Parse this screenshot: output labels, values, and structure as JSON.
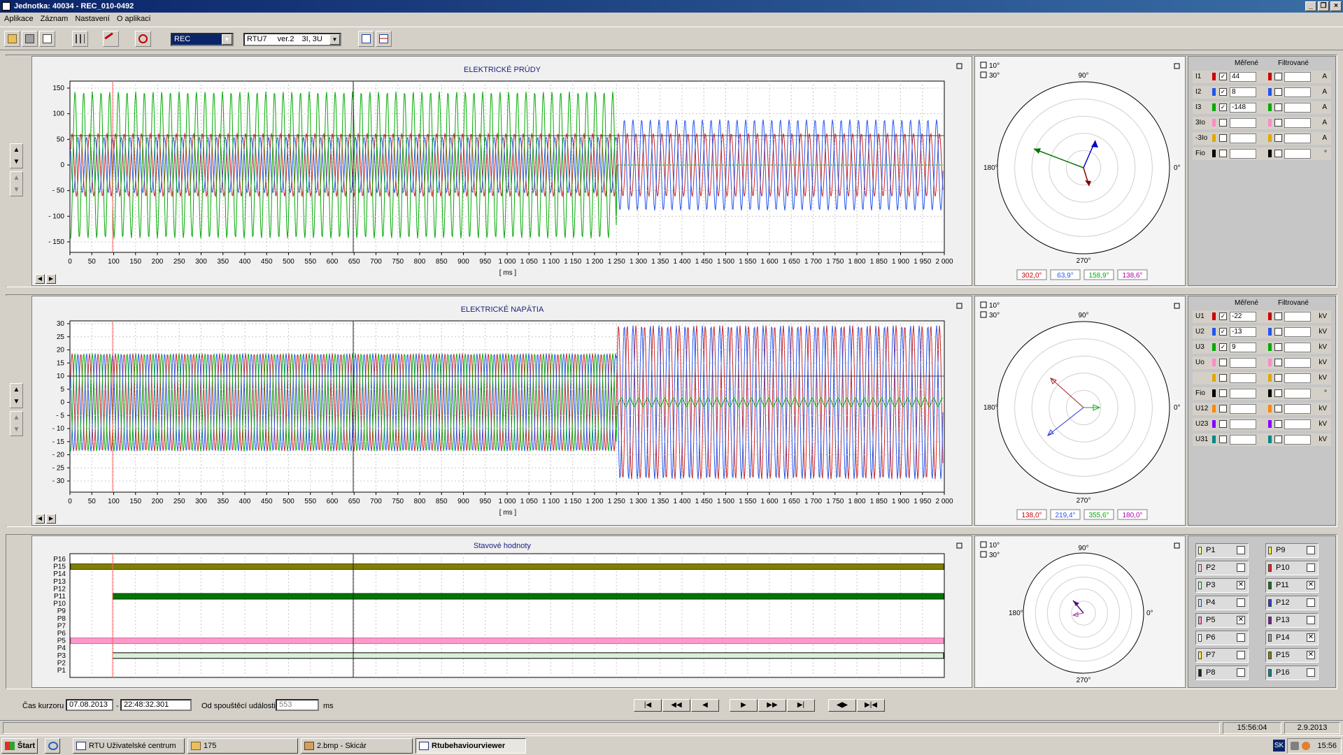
{
  "window": {
    "title": "Jednotka: 40034 - REC_010-0492"
  },
  "menu": [
    "Aplikace",
    "Záznam",
    "Nastavení",
    "O aplikaci"
  ],
  "toolbar": {
    "mode_select": "REC",
    "device_select": "RTU7",
    "device_version": "ver.2",
    "device_config": "3I, 3U"
  },
  "colors": {
    "phase1": "#cc0000",
    "phase2": "#2255ee",
    "phase3": "#00aa00",
    "bg": "#d4d0c8"
  },
  "currents": {
    "title": "ELEKTRICKÉ PRÚDY",
    "y_ticks": [
      "150",
      "100",
      "50",
      "0",
      "- 50",
      "- 100",
      "- 150"
    ],
    "x_unit": "[ ms ]",
    "polar_angles": [
      "302,0°",
      "63,9°",
      "158,9°",
      "138,6°"
    ],
    "legend_header_measured": "Měřené",
    "legend_header_filtered": "Filtrované",
    "rows": [
      {
        "label": "I1",
        "value": "44",
        "unit": "A"
      },
      {
        "label": "I2",
        "value": "8",
        "unit": "A"
      },
      {
        "label": "I3",
        "value": "-148",
        "unit": "A"
      },
      {
        "label": "3Io",
        "value": "",
        "unit": "A"
      },
      {
        "label": "-3Io",
        "value": "",
        "unit": "A"
      },
      {
        "label": "Fio",
        "value": "",
        "unit": "°"
      }
    ]
  },
  "voltages": {
    "title": "ELEKTRICKÉ NAPÄTIA",
    "y_ticks": [
      "30",
      "25",
      "20",
      "15",
      "10",
      "5",
      "0",
      "- 5",
      "- 10",
      "- 15",
      "- 20",
      "- 25",
      "- 30"
    ],
    "x_unit": "[ ms ]",
    "polar_angles": [
      "138,0°",
      "219,4°",
      "355,6°",
      "180,0°"
    ],
    "legend_header_measured": "Měřené",
    "legend_header_filtered": "Filtrované",
    "rows": [
      {
        "label": "U1",
        "value": "-22",
        "unit": "kV"
      },
      {
        "label": "U2",
        "value": "-13",
        "unit": "kV"
      },
      {
        "label": "U3",
        "value": "9",
        "unit": "kV"
      },
      {
        "label": "Uo",
        "value": "",
        "unit": "kV"
      },
      {
        "label": "",
        "value": "",
        "unit": "kV"
      },
      {
        "label": "Fio",
        "value": "",
        "unit": "°"
      },
      {
        "label": "U12",
        "value": "",
        "unit": "kV"
      },
      {
        "label": "U23",
        "value": "",
        "unit": "kV"
      },
      {
        "label": "U31",
        "value": "",
        "unit": "kV"
      }
    ]
  },
  "status": {
    "title": "Stavové hodnoty",
    "y_labels": [
      "P16",
      "P15",
      "P14",
      "P13",
      "P12",
      "P11",
      "P10",
      "P9",
      "P8",
      "P7",
      "P6",
      "P5",
      "P4",
      "P3",
      "P2",
      "P1"
    ],
    "inputs_left": [
      {
        "label": "P1",
        "checked": false
      },
      {
        "label": "P2",
        "checked": false
      },
      {
        "label": "P3",
        "checked": true
      },
      {
        "label": "P4",
        "checked": false
      },
      {
        "label": "P5",
        "checked": true
      },
      {
        "label": "P6",
        "checked": false
      },
      {
        "label": "P7",
        "checked": false
      },
      {
        "label": "P8",
        "checked": false
      }
    ],
    "inputs_right": [
      {
        "label": "P9",
        "checked": false
      },
      {
        "label": "P10",
        "checked": false
      },
      {
        "label": "P11",
        "checked": true
      },
      {
        "label": "P12",
        "checked": false
      },
      {
        "label": "P13",
        "checked": false
      },
      {
        "label": "P14",
        "checked": true
      },
      {
        "label": "P15",
        "checked": true
      },
      {
        "label": "P16",
        "checked": false
      }
    ]
  },
  "x_ticks": [
    "0",
    "50",
    "100",
    "150",
    "200",
    "250",
    "300",
    "350",
    "400",
    "450",
    "500",
    "550",
    "600",
    "650",
    "700",
    "750",
    "800",
    "850",
    "900",
    "950",
    "1 000",
    "1 050",
    "1 100",
    "1 150",
    "1 200",
    "1 250",
    "1 300",
    "1 350",
    "1 400",
    "1 450",
    "1 500",
    "1 550",
    "1 600",
    "1 650",
    "1 700",
    "1 750",
    "1 800",
    "1 850",
    "1 900",
    "1 950",
    "2 000"
  ],
  "polar": {
    "deg10": "10°",
    "deg30": "30°",
    "north": "90°",
    "west": "180°",
    "east": "0°",
    "south": "270°"
  },
  "cursor": {
    "label": "Čas kurzoru",
    "date": "07.08.2013",
    "time": "22:48:32.301",
    "event_label": "Od spouštěcí události",
    "event_value": "553",
    "event_unit": "ms"
  },
  "statusbar": {
    "time": "15:56:04",
    "date": "2.9.2013"
  },
  "taskbar": {
    "start": "Štart",
    "tasks": [
      "RTU Uživatelské centrum",
      "175",
      "2.bmp - Skicár",
      "Rtubehaviourviewer"
    ],
    "lang": "SK",
    "clock": "15:56"
  }
}
